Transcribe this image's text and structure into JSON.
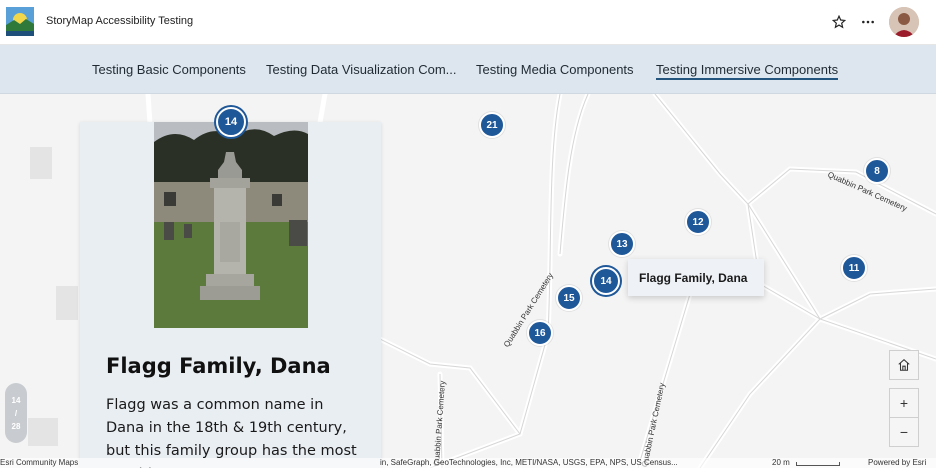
{
  "header": {
    "title": "StoryMap Accessibility Testing",
    "star_icon": "star-icon",
    "more_icon": "more-horizontal-icon"
  },
  "nav": {
    "items": [
      {
        "label": "Testing Basic Components"
      },
      {
        "label": "Testing Data Visualization Com..."
      },
      {
        "label": "Testing Media Components"
      },
      {
        "label": "Testing Immersive Components",
        "active": true
      }
    ]
  },
  "map": {
    "clusters": [
      "14",
      "21",
      "8",
      "12",
      "13",
      "14",
      "15",
      "16",
      "11"
    ],
    "road_labels": [
      "Quabbin Park Cemetery",
      "Quabbin Park Cemetery",
      "Quabbin Park Cemetery",
      "Quabbin Park Cemetery"
    ],
    "popup": "Flagg Family, Dana"
  },
  "card": {
    "title": "Flagg Family, Dana",
    "body": "Flagg was a common name in Dana in the 18th & 19th century, but this family group has the most notable"
  },
  "progress": {
    "current": "14",
    "separator": "/",
    "total": "28"
  },
  "controls": {
    "home_icon": "home-icon",
    "zoom_in": "+",
    "zoom_out": "−"
  },
  "attribution": {
    "left": "Esri Community Maps",
    "middle": "in, SafeGraph, GeoTechnologies, Inc, METI/NASA, USGS, EPA, NPS, US Census...",
    "scale": "20 m",
    "powered": "Powered by Esri"
  },
  "colors": {
    "accent": "#1f5899",
    "nav_bg": "#dde6ee",
    "card_bg": "#e9eef3"
  }
}
